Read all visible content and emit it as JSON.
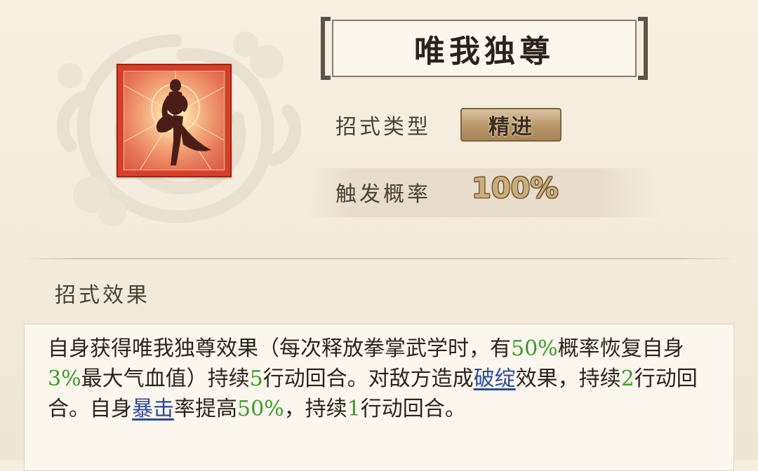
{
  "skill": {
    "title": "唯我独尊",
    "type_label": "招式类型",
    "type_value": "精进",
    "trigger_label": "触发概率",
    "trigger_value": "100%",
    "effect_heading": "招式效果",
    "effect_segments": [
      {
        "text": "自身获得唯我独尊效果（每次释放拳掌武学时，有",
        "style": "plain"
      },
      {
        "text": "50%",
        "style": "green"
      },
      {
        "text": "概率恢复自身",
        "style": "plain"
      },
      {
        "text": "3%",
        "style": "green"
      },
      {
        "text": "最大气血值）持续",
        "style": "plain"
      },
      {
        "text": "5",
        "style": "green"
      },
      {
        "text": "行动回合。对敌方造成",
        "style": "plain"
      },
      {
        "text": "破绽",
        "style": "keyword"
      },
      {
        "text": "效果，持续",
        "style": "plain"
      },
      {
        "text": "2",
        "style": "green"
      },
      {
        "text": "行动回合。自身",
        "style": "plain"
      },
      {
        "text": "暴击",
        "style": "keyword"
      },
      {
        "text": "率提高",
        "style": "plain"
      },
      {
        "text": "50%",
        "style": "green"
      },
      {
        "text": "，持续",
        "style": "plain"
      },
      {
        "text": "1",
        "style": "green"
      },
      {
        "text": "行动回合。",
        "style": "plain"
      }
    ]
  },
  "icons": {
    "skill_icon": "meditating-figure-icon",
    "background": "swirl-cloud-emblem"
  },
  "colors": {
    "highlight_green": "#3e9a28",
    "keyword_blue": "#2c4a9a",
    "icon_frame": "#d6402a"
  }
}
